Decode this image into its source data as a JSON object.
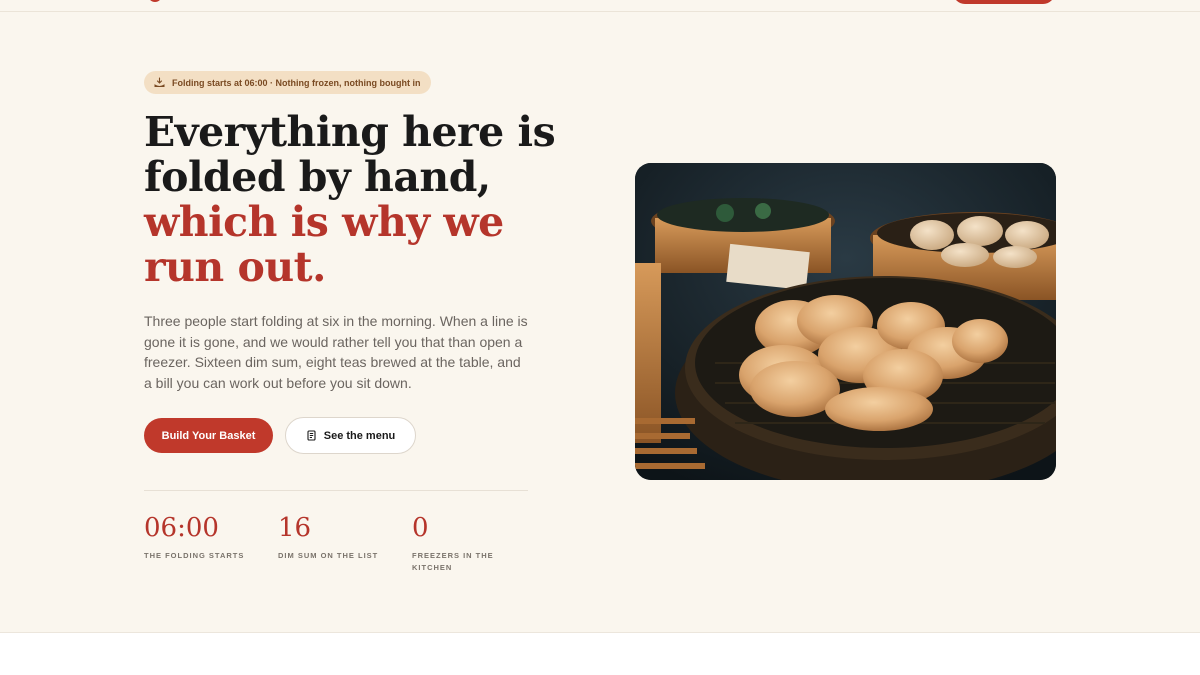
{
  "eyebrow": {
    "icon": "dumpling-icon",
    "text": "Folding starts at 06:00 · Nothing frozen, nothing bought in"
  },
  "headline": {
    "line1": "Everything here is",
    "line2": "folded by hand,",
    "accent_line1": "which is why we",
    "accent_line2": "run out."
  },
  "lede": "Three people start folding at six in the morning. When a line is gone it is gone, and we would rather tell you that than open a freezer. Sixteen dim sum, eight teas brewed at the table, and a bill you can work out before you sit down.",
  "buttons": {
    "primary_label": "Build Your Basket",
    "secondary_label": "See the menu",
    "secondary_icon": "menu-scroll-icon"
  },
  "stats": [
    {
      "value": "06:00",
      "label": "THE FOLDING STARTS"
    },
    {
      "value": "16",
      "label": "DIM SUM ON THE LIST"
    },
    {
      "value": "0",
      "label": "FREEZERS IN THE KITCHEN"
    }
  ],
  "hero_image": {
    "subject": "dumplings-in-bamboo-steamer"
  },
  "colors": {
    "accent": "#c0392b",
    "accent_text": "#b5352b",
    "background": "#faf6ee",
    "eyebrow_bg": "#f3dfc4"
  }
}
